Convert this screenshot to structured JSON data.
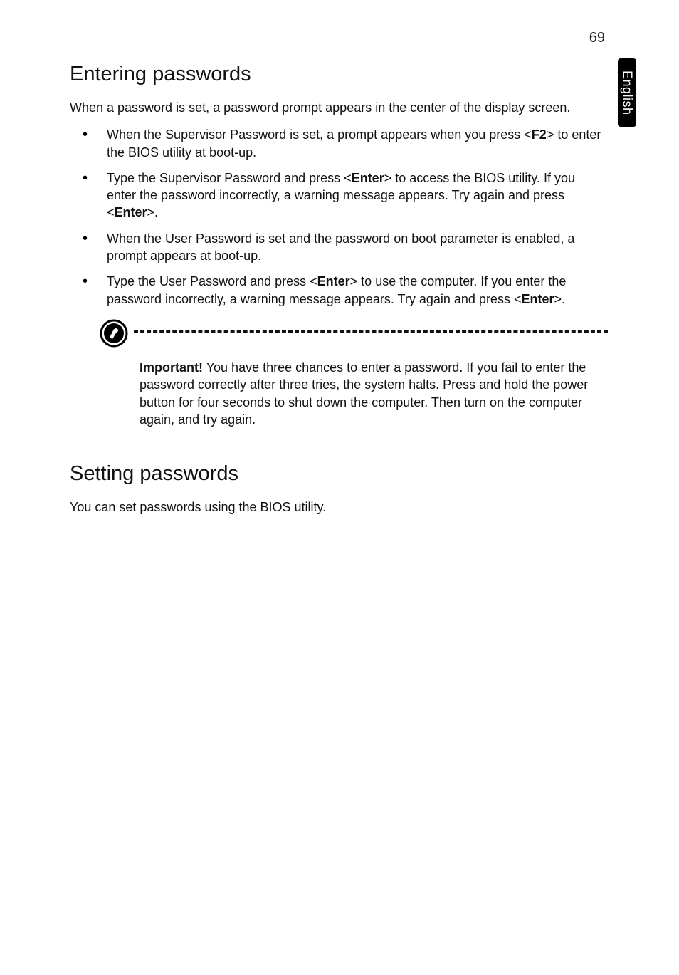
{
  "page_number": "69",
  "side_tab": "English",
  "sections": {
    "entering": {
      "heading": "Entering passwords",
      "intro": "When a password is set, a password prompt appears in the center of the display screen.",
      "bullets": [
        {
          "pre": "When the Supervisor Password is set, a prompt appears when you press <",
          "key": "F2",
          "post": "> to enter the BIOS utility at boot-up."
        },
        {
          "pre": "Type the Supervisor Password and press <",
          "key": "Enter",
          "mid": "> to access the BIOS utility. If you enter the password incorrectly, a warning message appears. Try again and press <",
          "key2": "Enter",
          "post": ">."
        },
        {
          "text": "When the User Password is set and the password on boot parameter is enabled, a prompt appears at boot-up."
        },
        {
          "pre": "Type the User Password and press <",
          "key": "Enter",
          "mid": "> to use the computer. If you enter the password incorrectly, a warning message appears. Try again and press <",
          "key2": "Enter",
          "post": ">."
        }
      ],
      "note": {
        "label": "Important!",
        "text": " You have three chances to enter a password. If you fail to enter the password correctly after three tries, the system halts. Press and hold the power button for four seconds to shut down the computer. Then turn on the computer again, and try again."
      }
    },
    "setting": {
      "heading": "Setting passwords",
      "intro": "You can set passwords using the BIOS utility."
    }
  }
}
